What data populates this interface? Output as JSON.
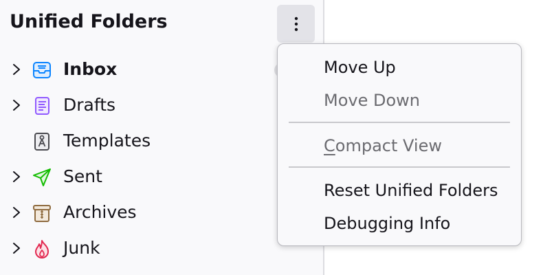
{
  "pane": {
    "title": "Unified Folders",
    "menu_button_icon": "vertical-ellipsis-icon"
  },
  "folders": [
    {
      "label": "Inbox",
      "icon": "inbox-icon",
      "has_twisty": true,
      "bold": true,
      "color": "#0a84ff"
    },
    {
      "label": "Drafts",
      "icon": "drafts-icon",
      "has_twisty": true,
      "bold": false,
      "color": "#9059ff"
    },
    {
      "label": "Templates",
      "icon": "templates-icon",
      "has_twisty": false,
      "bold": false,
      "color": "#4a4a4f"
    },
    {
      "label": "Sent",
      "icon": "sent-icon",
      "has_twisty": true,
      "bold": false,
      "color": "#12bc00"
    },
    {
      "label": "Archives",
      "icon": "archives-icon",
      "has_twisty": true,
      "bold": false,
      "color": "#8f6b3f"
    },
    {
      "label": "Junk",
      "icon": "junk-icon",
      "has_twisty": true,
      "bold": false,
      "color": "#e22850"
    }
  ],
  "context_menu": {
    "move_up": "Move Up",
    "move_down": "Move Down",
    "compact_view_first": "C",
    "compact_view_rest": "ompact View",
    "reset": "Reset Unified Folders",
    "debug": "Debugging Info"
  },
  "colors": {
    "background": "#f9f9fb",
    "menu_border": "#b7b7bd",
    "disabled_text": "#6b6b70"
  }
}
